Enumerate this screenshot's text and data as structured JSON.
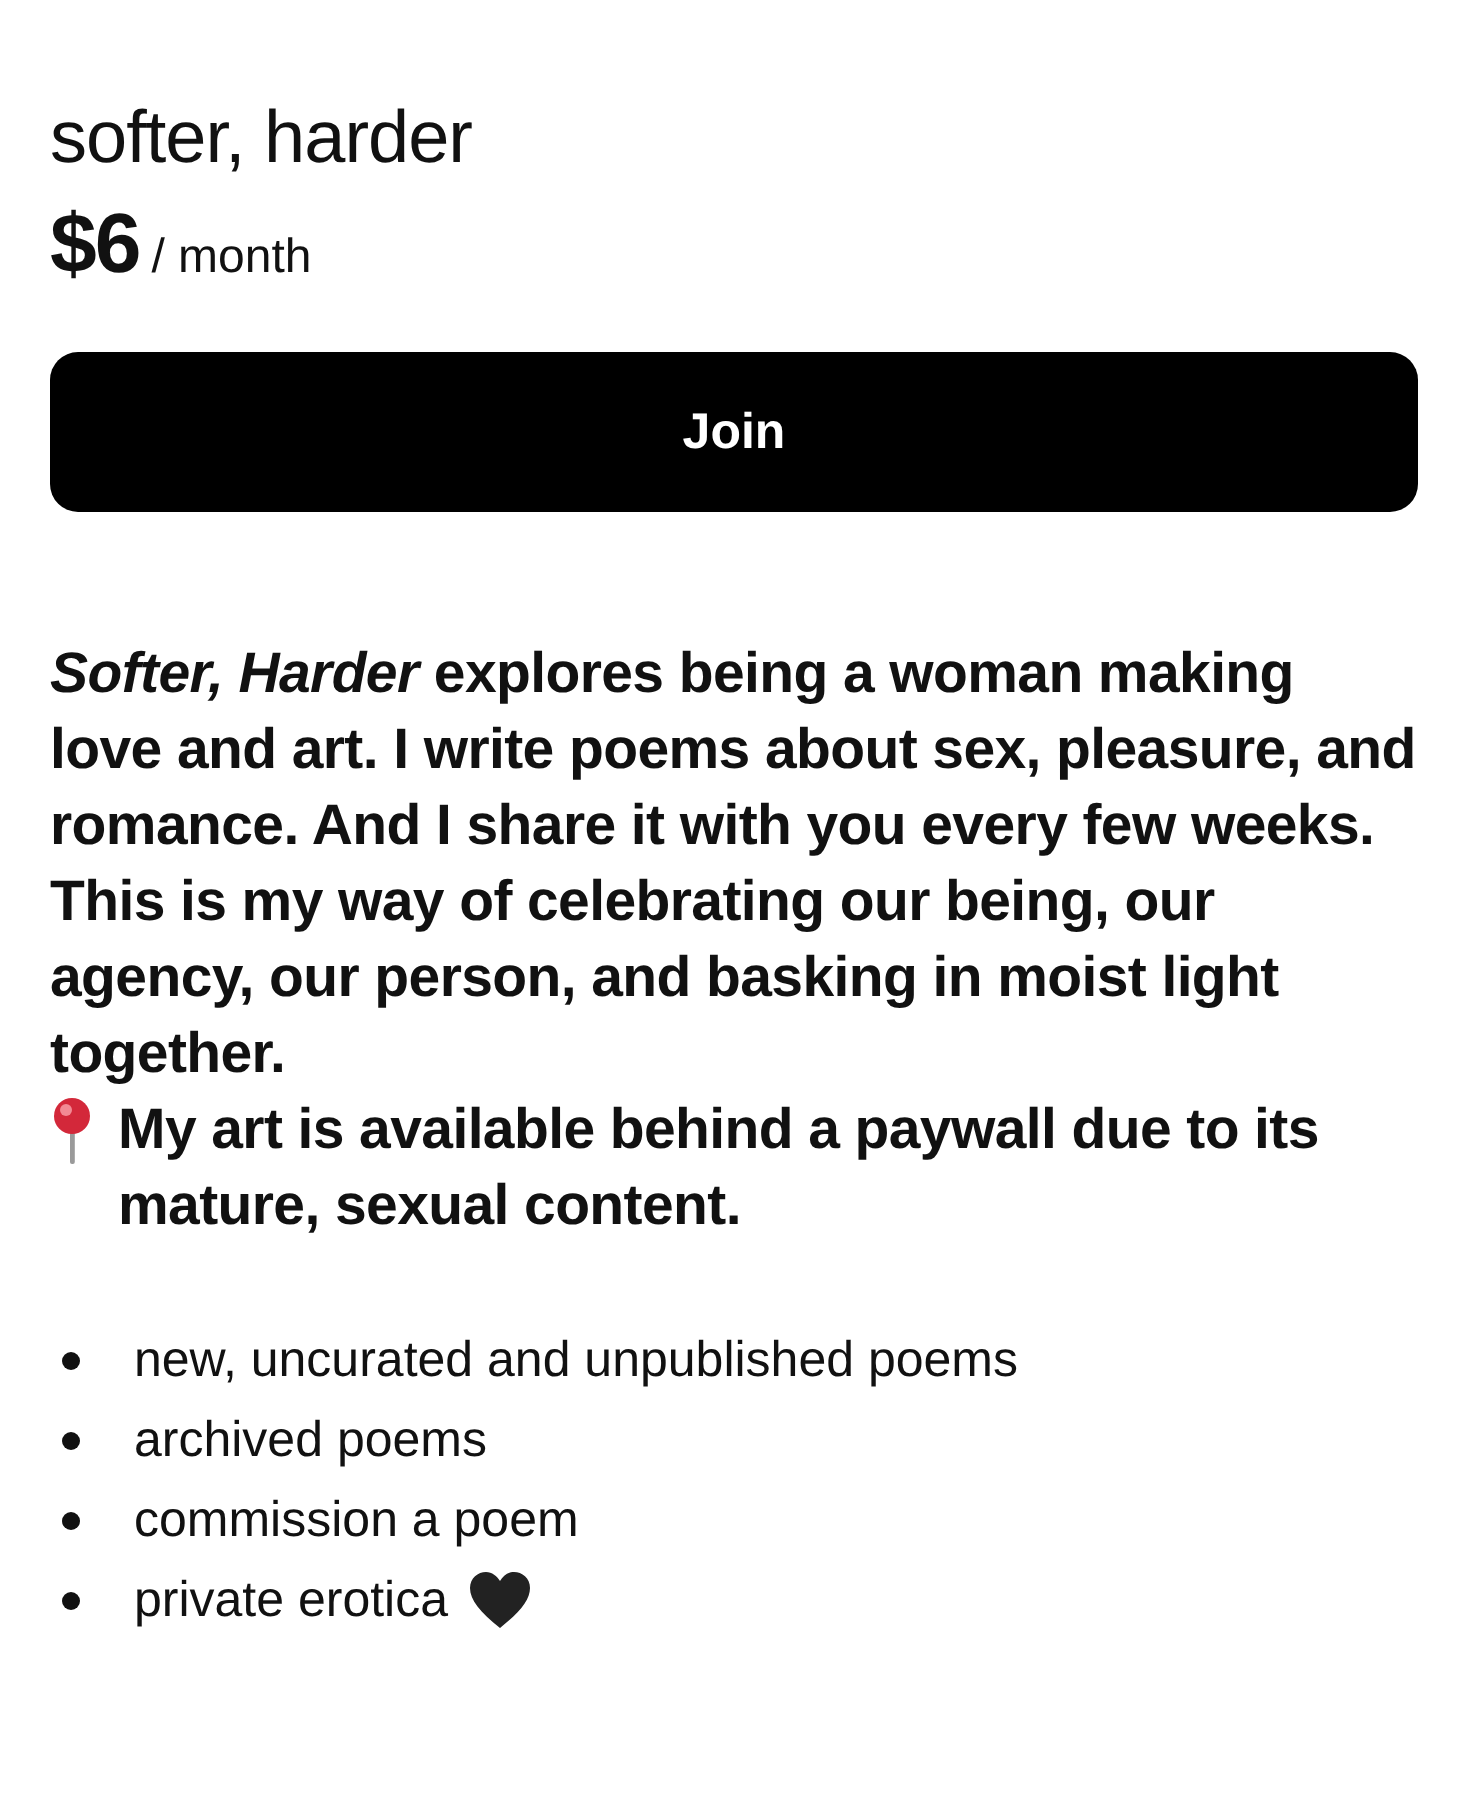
{
  "tier": {
    "title": "softer, harder",
    "price": "$6",
    "period": "/ month"
  },
  "join_button": {
    "label": "Join"
  },
  "description": {
    "text_before": "*Softer, Harder* explores being a woman making love and art. I write poems about sex, pleasure, and romance. And I share it with you every few weeks. This is my way of celebrating our being, our agency, our person, and basking in moist light together.",
    "text_after": "My art is available behind a paywall due to its mature, sexual content."
  },
  "benefits": [
    {
      "text": "new, uncurated and unpublished poems",
      "kind": "plain"
    },
    {
      "text": "archived poems",
      "kind": "plain"
    },
    {
      "text": "commission a poem",
      "kind": "plain"
    },
    {
      "text": "private erotica",
      "kind": "heart"
    }
  ]
}
